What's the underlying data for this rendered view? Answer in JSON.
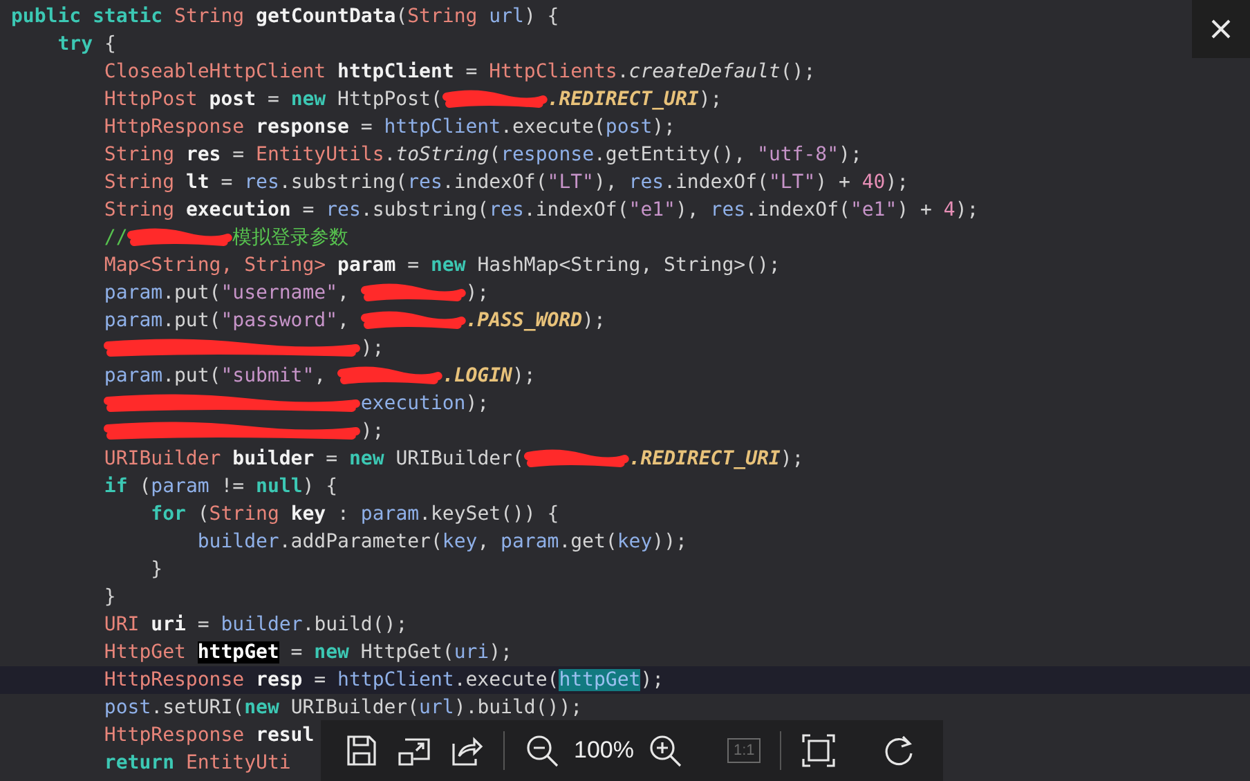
{
  "code_lines": [
    {
      "highlighted": false,
      "tokens": [
        {
          "kind": "keyword",
          "text": "public static "
        },
        {
          "kind": "type",
          "text": "String "
        },
        {
          "kind": "decl",
          "text": "getCountData"
        },
        {
          "kind": "plain",
          "text": "("
        },
        {
          "kind": "type",
          "text": "String "
        },
        {
          "kind": "ident",
          "text": "url"
        },
        {
          "kind": "plain",
          "text": ") {"
        }
      ]
    },
    {
      "highlighted": false,
      "tokens": [
        {
          "kind": "keyword",
          "text": "    try"
        },
        {
          "kind": "plain",
          "text": " {"
        }
      ]
    },
    {
      "highlighted": false,
      "tokens": [
        {
          "kind": "type",
          "text": "        CloseableHttpClient "
        },
        {
          "kind": "decl",
          "text": "httpClient"
        },
        {
          "kind": "plain",
          "text": " = "
        },
        {
          "kind": "type",
          "text": "HttpClients"
        },
        {
          "kind": "plain",
          "text": "."
        },
        {
          "kind": "static",
          "text": "createDefault"
        },
        {
          "kind": "plain",
          "text": "();"
        }
      ]
    },
    {
      "highlighted": false,
      "tokens": [
        {
          "kind": "type",
          "text": "        HttpPost "
        },
        {
          "kind": "decl",
          "text": "post"
        },
        {
          "kind": "plain",
          "text": " = "
        },
        {
          "kind": "keyword",
          "text": "new"
        },
        {
          "kind": "plain",
          "text": " HttpPost("
        },
        {
          "kind": "redaction"
        },
        {
          "kind": "const",
          "text": ".REDIRECT_URI"
        },
        {
          "kind": "plain",
          "text": ");"
        }
      ]
    },
    {
      "highlighted": false,
      "tokens": [
        {
          "kind": "type",
          "text": "        HttpResponse "
        },
        {
          "kind": "decl",
          "text": "response"
        },
        {
          "kind": "plain",
          "text": " = "
        },
        {
          "kind": "ident",
          "text": "httpClient"
        },
        {
          "kind": "plain",
          "text": ".execute("
        },
        {
          "kind": "ident",
          "text": "post"
        },
        {
          "kind": "plain",
          "text": ");"
        }
      ]
    },
    {
      "highlighted": false,
      "tokens": [
        {
          "kind": "type",
          "text": "        String "
        },
        {
          "kind": "decl",
          "text": "res"
        },
        {
          "kind": "plain",
          "text": " = "
        },
        {
          "kind": "type",
          "text": "EntityUtils"
        },
        {
          "kind": "plain",
          "text": "."
        },
        {
          "kind": "static",
          "text": "toString"
        },
        {
          "kind": "plain",
          "text": "("
        },
        {
          "kind": "ident",
          "text": "response"
        },
        {
          "kind": "plain",
          "text": ".getEntity(), "
        },
        {
          "kind": "string",
          "text": "\"utf-8\""
        },
        {
          "kind": "plain",
          "text": ");"
        }
      ]
    },
    {
      "highlighted": false,
      "tokens": [
        {
          "kind": "type",
          "text": "        String "
        },
        {
          "kind": "decl",
          "text": "lt"
        },
        {
          "kind": "plain",
          "text": " = "
        },
        {
          "kind": "ident",
          "text": "res"
        },
        {
          "kind": "plain",
          "text": ".substring("
        },
        {
          "kind": "ident",
          "text": "res"
        },
        {
          "kind": "plain",
          "text": ".indexOf("
        },
        {
          "kind": "string",
          "text": "\"LT\""
        },
        {
          "kind": "plain",
          "text": "), "
        },
        {
          "kind": "ident",
          "text": "res"
        },
        {
          "kind": "plain",
          "text": ".indexOf("
        },
        {
          "kind": "string",
          "text": "\"LT\""
        },
        {
          "kind": "plain",
          "text": ") + "
        },
        {
          "kind": "number",
          "text": "40"
        },
        {
          "kind": "plain",
          "text": ");"
        }
      ]
    },
    {
      "highlighted": false,
      "tokens": [
        {
          "kind": "type",
          "text": "        String "
        },
        {
          "kind": "decl",
          "text": "execution"
        },
        {
          "kind": "plain",
          "text": " = "
        },
        {
          "kind": "ident",
          "text": "res"
        },
        {
          "kind": "plain",
          "text": ".substring("
        },
        {
          "kind": "ident",
          "text": "res"
        },
        {
          "kind": "plain",
          "text": ".indexOf("
        },
        {
          "kind": "string",
          "text": "\"e1\""
        },
        {
          "kind": "plain",
          "text": "), "
        },
        {
          "kind": "ident",
          "text": "res"
        },
        {
          "kind": "plain",
          "text": ".indexOf("
        },
        {
          "kind": "string",
          "text": "\"e1\""
        },
        {
          "kind": "plain",
          "text": ") + "
        },
        {
          "kind": "number",
          "text": "4"
        },
        {
          "kind": "plain",
          "text": ");"
        }
      ]
    },
    {
      "highlighted": false,
      "tokens": [
        {
          "kind": "comment",
          "text": "        //"
        },
        {
          "kind": "redaction"
        },
        {
          "kind": "comment",
          "text": "模拟登录参数"
        }
      ]
    },
    {
      "highlighted": false,
      "tokens": [
        {
          "kind": "type",
          "text": "        Map<String, String> "
        },
        {
          "kind": "decl",
          "text": "param"
        },
        {
          "kind": "plain",
          "text": " = "
        },
        {
          "kind": "keyword",
          "text": "new"
        },
        {
          "kind": "plain",
          "text": " HashMap<String, String>();"
        }
      ]
    },
    {
      "highlighted": false,
      "tokens": [
        {
          "kind": "ident",
          "text": "        param"
        },
        {
          "kind": "plain",
          "text": ".put("
        },
        {
          "kind": "string",
          "text": "\"username\""
        },
        {
          "kind": "plain",
          "text": ", "
        },
        {
          "kind": "redaction"
        },
        {
          "kind": "plain",
          "text": ");"
        }
      ]
    },
    {
      "highlighted": false,
      "tokens": [
        {
          "kind": "ident",
          "text": "        param"
        },
        {
          "kind": "plain",
          "text": ".put("
        },
        {
          "kind": "string",
          "text": "\"password\""
        },
        {
          "kind": "plain",
          "text": ", "
        },
        {
          "kind": "redaction"
        },
        {
          "kind": "const",
          "text": ".PASS_WORD"
        },
        {
          "kind": "plain",
          "text": ");"
        }
      ]
    },
    {
      "highlighted": false,
      "tokens": [
        {
          "kind": "redaction"
        },
        {
          "kind": "plain",
          "text": ");"
        }
      ]
    },
    {
      "highlighted": false,
      "tokens": [
        {
          "kind": "ident",
          "text": "        param"
        },
        {
          "kind": "plain",
          "text": ".put("
        },
        {
          "kind": "string",
          "text": "\"submit\""
        },
        {
          "kind": "plain",
          "text": ", "
        },
        {
          "kind": "redaction"
        },
        {
          "kind": "const",
          "text": ".LOGIN"
        },
        {
          "kind": "plain",
          "text": ");"
        }
      ]
    },
    {
      "highlighted": false,
      "tokens": [
        {
          "kind": "redaction"
        },
        {
          "kind": "ident",
          "text": "execution"
        },
        {
          "kind": "plain",
          "text": ");"
        }
      ]
    },
    {
      "highlighted": false,
      "tokens": [
        {
          "kind": "redaction"
        },
        {
          "kind": "plain",
          "text": ");"
        }
      ]
    },
    {
      "highlighted": false,
      "tokens": [
        {
          "kind": "type",
          "text": "        URIBuilder "
        },
        {
          "kind": "decl",
          "text": "builder"
        },
        {
          "kind": "plain",
          "text": " = "
        },
        {
          "kind": "keyword",
          "text": "new"
        },
        {
          "kind": "plain",
          "text": " URIBuilder("
        },
        {
          "kind": "redaction"
        },
        {
          "kind": "const",
          "text": ".REDIRECT_URI"
        },
        {
          "kind": "plain",
          "text": ");"
        }
      ]
    },
    {
      "highlighted": false,
      "tokens": [
        {
          "kind": "keyword",
          "text": "        if"
        },
        {
          "kind": "plain",
          "text": " ("
        },
        {
          "kind": "ident",
          "text": "param"
        },
        {
          "kind": "plain",
          "text": " != "
        },
        {
          "kind": "keyword",
          "text": "null"
        },
        {
          "kind": "plain",
          "text": ") {"
        }
      ]
    },
    {
      "highlighted": false,
      "tokens": [
        {
          "kind": "keyword",
          "text": "            for"
        },
        {
          "kind": "plain",
          "text": " ("
        },
        {
          "kind": "type",
          "text": "String "
        },
        {
          "kind": "decl",
          "text": "key"
        },
        {
          "kind": "plain",
          "text": " : "
        },
        {
          "kind": "ident",
          "text": "param"
        },
        {
          "kind": "plain",
          "text": ".keySet()) {"
        }
      ]
    },
    {
      "highlighted": false,
      "tokens": [
        {
          "kind": "ident",
          "text": "                builder"
        },
        {
          "kind": "plain",
          "text": ".addParameter("
        },
        {
          "kind": "ident",
          "text": "key"
        },
        {
          "kind": "plain",
          "text": ", "
        },
        {
          "kind": "ident",
          "text": "param"
        },
        {
          "kind": "plain",
          "text": ".get("
        },
        {
          "kind": "ident",
          "text": "key"
        },
        {
          "kind": "plain",
          "text": "));"
        }
      ]
    },
    {
      "highlighted": false,
      "tokens": [
        {
          "kind": "plain",
          "text": "            }"
        }
      ]
    },
    {
      "highlighted": false,
      "tokens": [
        {
          "kind": "plain",
          "text": "        }"
        }
      ]
    },
    {
      "highlighted": false,
      "tokens": [
        {
          "kind": "type",
          "text": "        URI "
        },
        {
          "kind": "decl",
          "text": "uri"
        },
        {
          "kind": "plain",
          "text": " = "
        },
        {
          "kind": "ident",
          "text": "builder"
        },
        {
          "kind": "plain",
          "text": ".build();"
        }
      ]
    },
    {
      "highlighted": false,
      "tokens": [
        {
          "kind": "type",
          "text": "        HttpGet "
        },
        {
          "kind": "selection",
          "text": "httpGet"
        },
        {
          "kind": "plain",
          "text": " = "
        },
        {
          "kind": "keyword",
          "text": "new"
        },
        {
          "kind": "plain",
          "text": " HttpGet("
        },
        {
          "kind": "ident",
          "text": "uri"
        },
        {
          "kind": "plain",
          "text": ");"
        }
      ]
    },
    {
      "highlighted": true,
      "tokens": [
        {
          "kind": "type",
          "text": "        HttpResponse "
        },
        {
          "kind": "decl",
          "text": "resp"
        },
        {
          "kind": "plain",
          "text": " = "
        },
        {
          "kind": "ident",
          "text": "httpClient"
        },
        {
          "kind": "plain",
          "text": ".execute("
        },
        {
          "kind": "match",
          "text": "httpGet"
        },
        {
          "kind": "plain",
          "text": ");"
        }
      ]
    },
    {
      "highlighted": false,
      "tokens": [
        {
          "kind": "ident",
          "text": "        post"
        },
        {
          "kind": "plain",
          "text": ".setURI("
        },
        {
          "kind": "keyword",
          "text": "new"
        },
        {
          "kind": "plain",
          "text": " URIBuilder("
        },
        {
          "kind": "ident",
          "text": "url"
        },
        {
          "kind": "plain",
          "text": ").build());"
        }
      ]
    },
    {
      "highlighted": false,
      "tokens": [
        {
          "kind": "type",
          "text": "        HttpResponse "
        },
        {
          "kind": "decl",
          "text": "resul"
        }
      ]
    },
    {
      "highlighted": false,
      "tokens": [
        {
          "kind": "keyword",
          "text": "        return "
        },
        {
          "kind": "type",
          "text": "EntityUti"
        }
      ]
    }
  ],
  "toolbar": {
    "zoom": "100%",
    "actual_size_label": "1:1",
    "actual_size_disabled": true
  }
}
